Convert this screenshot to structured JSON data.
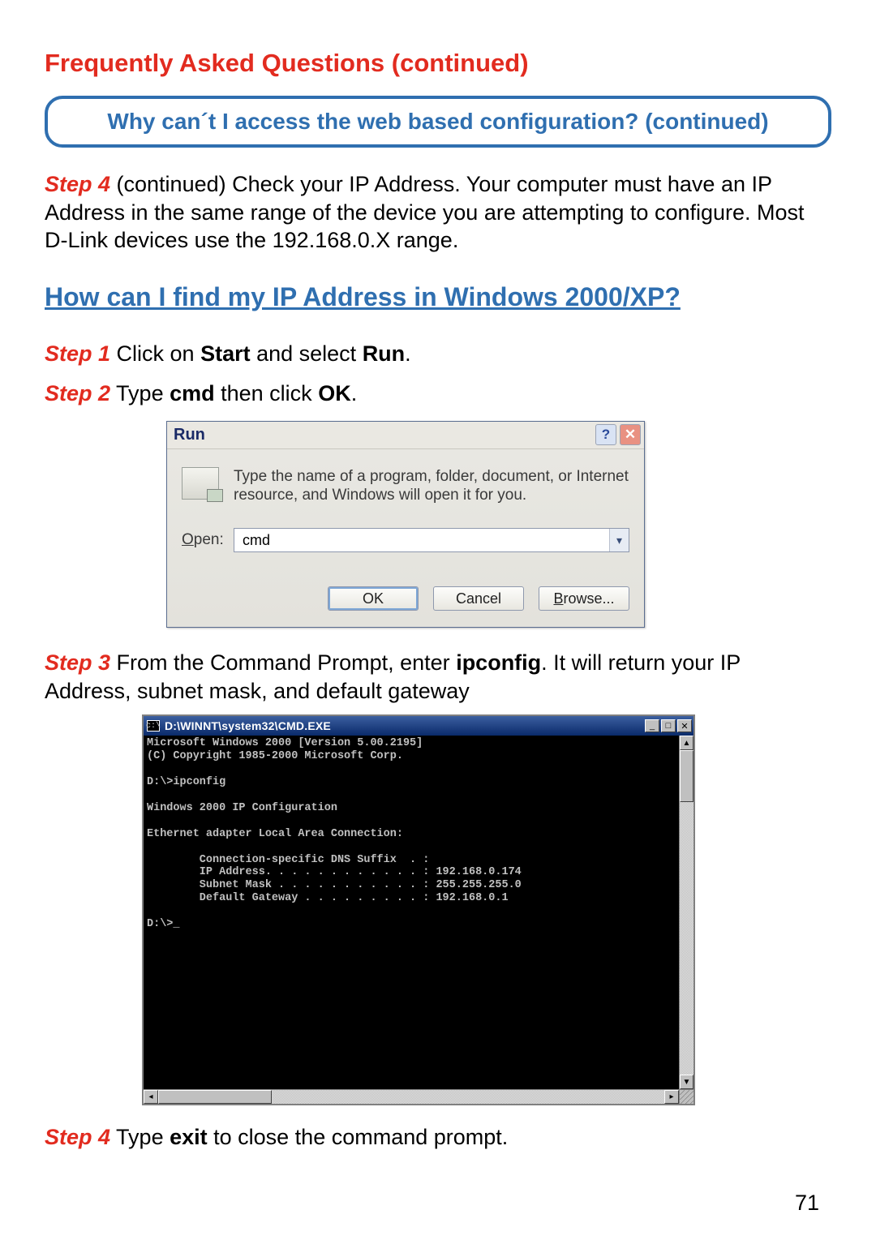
{
  "faq_title": "Frequently Asked Questions (continued)",
  "qbox": "Why can´t I access the web based configuration? (continued)",
  "intro": {
    "step_label": "Step 4",
    "cont": " (continued) ",
    "text": "Check your IP Address. Your computer must have an IP Address in the same range of the device you are attempting to configure. Most D-Link devices use the 192.168.0.X range."
  },
  "subheading": "How can I find my IP Address in Windows 2000/XP?",
  "step1": {
    "label": "Step 1",
    "pre": " Click on ",
    "b1": "Start",
    "mid": " and select ",
    "b2": "Run",
    "post": "."
  },
  "step2": {
    "label": "Step 2",
    "pre": " Type ",
    "b1": "cmd",
    "mid": " then click ",
    "b2": "OK",
    "post": "."
  },
  "run_dialog": {
    "title": "Run",
    "desc": "Type the name of a program, folder, document, or Internet resource, and Windows will open it for you.",
    "open_label_u": "O",
    "open_label_rest": "pen:",
    "value": "cmd",
    "ok": "OK",
    "cancel": "Cancel",
    "browse_u": "B",
    "browse_rest": "rowse..."
  },
  "step3": {
    "label": "Step 3",
    "pre": " From the Command Prompt, enter ",
    "b1": "ipconfig",
    "post_a": ". It will return your IP Address, subnet mask, and default gateway"
  },
  "cmd": {
    "title": "D:\\WINNT\\system32\\CMD.EXE",
    "content": "Microsoft Windows 2000 [Version 5.00.2195]\n(C) Copyright 1985-2000 Microsoft Corp.\n\nD:\\>ipconfig\n\nWindows 2000 IP Configuration\n\nEthernet adapter Local Area Connection:\n\n        Connection-specific DNS Suffix  . :\n        IP Address. . . . . . . . . . . . : 192.168.0.174\n        Subnet Mask . . . . . . . . . . . : 255.255.255.0\n        Default Gateway . . . . . . . . . : 192.168.0.1\n\nD:\\>_"
  },
  "step4": {
    "label": "Step 4",
    "pre": " Type ",
    "b1": "exit",
    "post": " to close the command prompt."
  },
  "page_number": "71"
}
